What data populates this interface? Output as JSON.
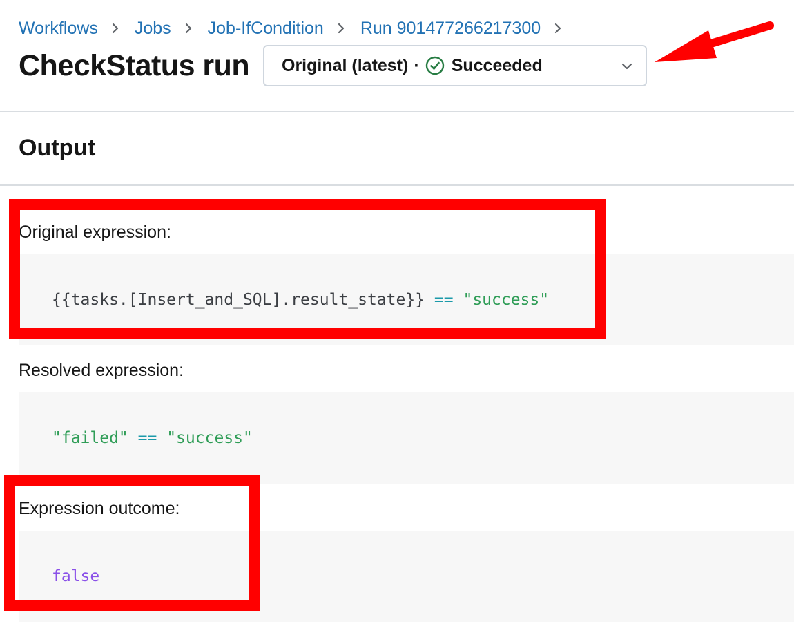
{
  "breadcrumb": {
    "items": [
      "Workflows",
      "Jobs",
      "Job-IfCondition",
      "Run 901477266217300"
    ]
  },
  "header": {
    "title": "CheckStatus run",
    "run_selector": {
      "attempt": "Original (latest)",
      "separator": "·",
      "status": "Succeeded",
      "status_icon": "check-circle-icon",
      "status_color": "#277c43"
    }
  },
  "output": {
    "title": "Output",
    "original": {
      "label": "Original expression:",
      "tokens": [
        "{{tasks.[Insert_and_SQL].result_state}}",
        "==",
        "\"success\""
      ]
    },
    "resolved": {
      "label": "Resolved expression:",
      "tokens": [
        "\"failed\"",
        "==",
        "\"success\""
      ]
    },
    "outcome": {
      "label": "Expression outcome:",
      "value": "false"
    }
  },
  "annotations": {
    "color": "#ff0000",
    "arrow_icon": "red-arrow-icon"
  }
}
